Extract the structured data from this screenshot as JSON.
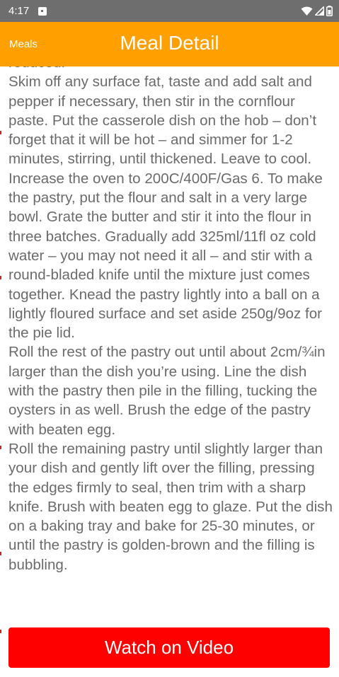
{
  "status_bar": {
    "time": "4:17",
    "icons": [
      "sim-card-icon",
      "wifi-icon",
      "signal-icon",
      "battery-icon"
    ]
  },
  "app_bar": {
    "back_label": "Meals",
    "title": "Meal Detail",
    "color": "#ffa000"
  },
  "instructions": {
    "text": "reduced.\nSkim off any surface fat, taste and add salt and pepper if necessary, then stir in the cornflour paste. Put the casserole dish on the hob – don’t forget that it will be hot – and simmer for 1-2 minutes, stirring, until thickened. Leave to cool.\nIncrease the oven to 200C/400F/Gas 6. To make the pastry, put the flour and salt in a very large bowl. Grate the butter and stir it into the flour in three batches. Gradually add 325ml/11fl oz cold water – you may not need it all – and stir with a round-bladed knife until the mixture just comes together. Knead the pastry lightly into a ball on a lightly floured surface and set aside 250g/9oz for the pie lid.\nRoll the rest of the pastry out until about 2cm/¾in larger than the dish you’re using. Line the dish with the pastry then pile in the filling, tucking the oysters in as well. Brush the edge of the pastry with beaten egg.\nRoll the remaining pastry until slightly larger than your dish and gently lift over the filling, pressing the edges firmly to seal, then trim with a sharp knife. Brush with beaten egg to glaze. Put the dish on a baking tray and bake for 25-30 minutes, or until the pastry is golden-brown and the filling is bubbling."
  },
  "video_button": {
    "label": "Watch on Video",
    "color": "#ff0000"
  }
}
